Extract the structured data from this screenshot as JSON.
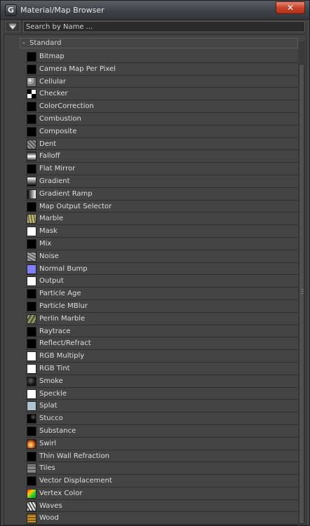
{
  "window": {
    "title": "Material/Map Browser",
    "app_icon_glyph": "G"
  },
  "search": {
    "placeholder": "Search by Name ..."
  },
  "group": {
    "toggle": "-",
    "label": "Standard"
  },
  "items": [
    {
      "label": "Bitmap",
      "icon": "black-swatch"
    },
    {
      "label": "Camera Map Per Pixel",
      "icon": "black-swatch"
    },
    {
      "label": "Cellular",
      "icon": "cellular-swatch"
    },
    {
      "label": "Checker",
      "icon": "checker-swatch"
    },
    {
      "label": "ColorCorrection",
      "icon": "black-swatch"
    },
    {
      "label": "Combustion",
      "icon": "black-swatch"
    },
    {
      "label": "Composite",
      "icon": "black-swatch"
    },
    {
      "label": "Dent",
      "icon": "dent-swatch"
    },
    {
      "label": "Falloff",
      "icon": "falloff-swatch"
    },
    {
      "label": "Flat Mirror",
      "icon": "black-swatch"
    },
    {
      "label": "Gradient",
      "icon": "gradient-swatch"
    },
    {
      "label": "Gradient Ramp",
      "icon": "gradient-ramp-swatch"
    },
    {
      "label": "Map Output Selector",
      "icon": "black-swatch"
    },
    {
      "label": "Marble",
      "icon": "marble-swatch"
    },
    {
      "label": "Mask",
      "icon": "white-swatch"
    },
    {
      "label": "Mix",
      "icon": "black-swatch"
    },
    {
      "label": "Noise",
      "icon": "noise-swatch"
    },
    {
      "label": "Normal Bump",
      "icon": "normal-bump-swatch"
    },
    {
      "label": "Output",
      "icon": "white-swatch"
    },
    {
      "label": "Particle Age",
      "icon": "black-swatch"
    },
    {
      "label": "Particle MBlur",
      "icon": "black-swatch"
    },
    {
      "label": "Perlin Marble",
      "icon": "perlin-marble-swatch"
    },
    {
      "label": "Raytrace",
      "icon": "black-swatch"
    },
    {
      "label": "Reflect/Refract",
      "icon": "black-swatch"
    },
    {
      "label": "RGB Multiply",
      "icon": "white-swatch"
    },
    {
      "label": "RGB Tint",
      "icon": "white-swatch"
    },
    {
      "label": "Smoke",
      "icon": "smoke-swatch"
    },
    {
      "label": "Speckle",
      "icon": "white-swatch"
    },
    {
      "label": "Splat",
      "icon": "splat-swatch"
    },
    {
      "label": "Stucco",
      "icon": "stucco-swatch"
    },
    {
      "label": "Substance",
      "icon": "black-swatch"
    },
    {
      "label": "Swirl",
      "icon": "swirl-swatch"
    },
    {
      "label": "Thin Wall Refraction",
      "icon": "black-swatch"
    },
    {
      "label": "Tiles",
      "icon": "tiles-swatch"
    },
    {
      "label": "Vector Displacement",
      "icon": "black-swatch"
    },
    {
      "label": "Vertex Color",
      "icon": "vertex-color-swatch"
    },
    {
      "label": "Waves",
      "icon": "waves-swatch"
    },
    {
      "label": "Wood",
      "icon": "wood-swatch"
    }
  ],
  "colors": {
    "panel_bg": "#444444",
    "close_button": "#c7432a",
    "normal_bump": "#8080ff"
  }
}
